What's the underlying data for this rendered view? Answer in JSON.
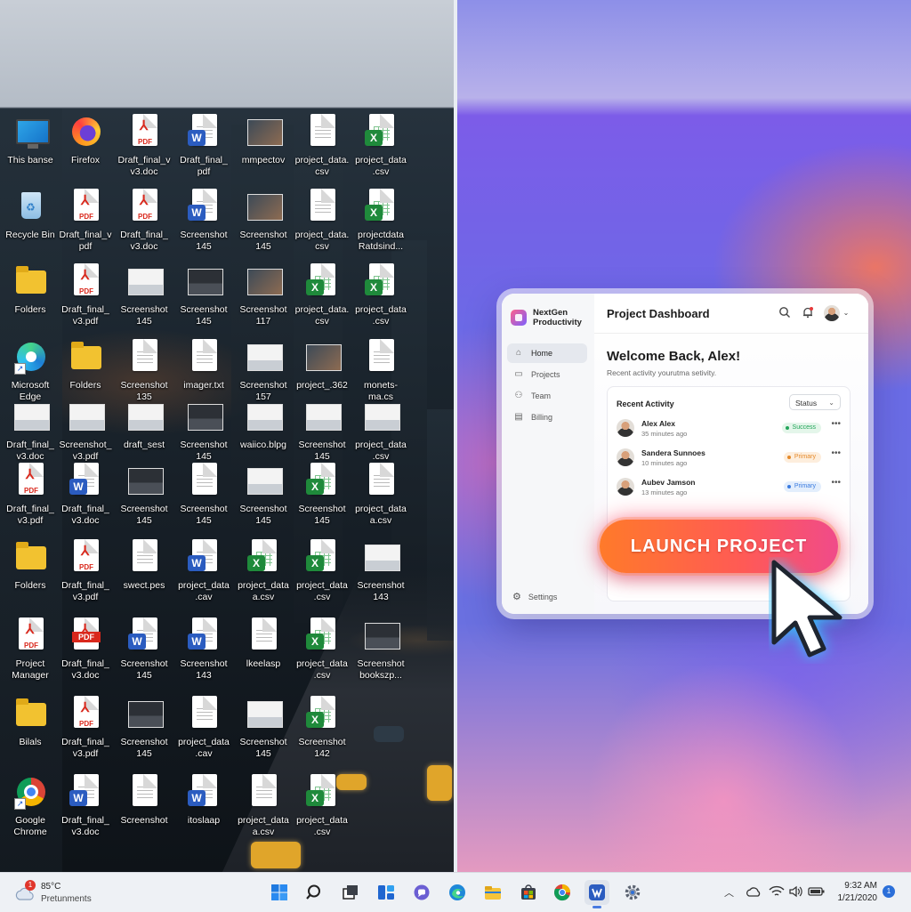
{
  "desktop": {
    "icons": [
      {
        "label": "This banse",
        "type": "monitor"
      },
      {
        "label": "Firefox",
        "type": "firefox"
      },
      {
        "label": "Draft_final_v v3.doc",
        "type": "pdf"
      },
      {
        "label": "Draft_final_ pdf",
        "type": "word"
      },
      {
        "label": "mmpectov",
        "type": "photo"
      },
      {
        "label": "project_data. csv",
        "type": "doc"
      },
      {
        "label": "project_data .csv",
        "type": "excel"
      },
      {
        "label": "Recycle Bin",
        "type": "bin"
      },
      {
        "label": "Draft_final_v pdf",
        "type": "pdf"
      },
      {
        "label": "Draft_final_ v3.doc",
        "type": "pdf"
      },
      {
        "label": "Screenshot 145",
        "type": "word"
      },
      {
        "label": "Screenshot 145",
        "type": "photo"
      },
      {
        "label": "project_data. csv",
        "type": "doc"
      },
      {
        "label": "projectdata Ratdsind...",
        "type": "excel"
      },
      {
        "label": "Folders",
        "type": "folder"
      },
      {
        "label": "Draft_final_ v3.pdf",
        "type": "pdf"
      },
      {
        "label": "Screenshot 145",
        "type": "thumb-light"
      },
      {
        "label": "Screenshot 145",
        "type": "thumb-dark"
      },
      {
        "label": "Screenshot 117",
        "type": "photo"
      },
      {
        "label": "project_data. csv",
        "type": "excel"
      },
      {
        "label": "project_data .csv",
        "type": "excel"
      },
      {
        "label": "Microsoft Edge",
        "type": "edge"
      },
      {
        "label": "Folders",
        "type": "folder"
      },
      {
        "label": "Screenshot 135",
        "type": "doc"
      },
      {
        "label": "imager.txt",
        "type": "doc"
      },
      {
        "label": "Screenshot 157",
        "type": "thumb-light"
      },
      {
        "label": "project_.362",
        "type": "photo"
      },
      {
        "label": "monets- ma.cs",
        "type": "doc"
      },
      {
        "label": "Draft_final_ v3.doc",
        "type": "thumb-light"
      },
      {
        "label": "Screenshot_ v3.pdf",
        "type": "thumb-light"
      },
      {
        "label": "draft_sest",
        "type": "thumb-light"
      },
      {
        "label": "Screenshot 145",
        "type": "thumb-dark"
      },
      {
        "label": "waiico.blpg",
        "type": "thumb-light"
      },
      {
        "label": "Screenshot 145",
        "type": "thumb-light"
      },
      {
        "label": "project_data .csv",
        "type": "thumb-light"
      },
      {
        "label": "Draft_final_ v3.pdf",
        "type": "pdf"
      },
      {
        "label": "Draft_final_ v3.doc",
        "type": "word"
      },
      {
        "label": "Screenshot 145",
        "type": "thumb-dark"
      },
      {
        "label": "Screenshot 145",
        "type": "doc"
      },
      {
        "label": "Screenshot 145",
        "type": "thumb-light"
      },
      {
        "label": "Screenshot 145",
        "type": "excel"
      },
      {
        "label": "project_data a.csv",
        "type": "doc"
      },
      {
        "label": "Folders",
        "type": "folder"
      },
      {
        "label": "Draft_final_ v3.pdf",
        "type": "pdf"
      },
      {
        "label": "swect.pes",
        "type": "doc"
      },
      {
        "label": "project_data .cav",
        "type": "word"
      },
      {
        "label": "project_data a.csv",
        "type": "excel"
      },
      {
        "label": "project_data .csv",
        "type": "excel"
      },
      {
        "label": "Screenshot 143",
        "type": "thumb-light"
      },
      {
        "label": "Project Manager",
        "type": "pdf"
      },
      {
        "label": "Draft_final_ v3.doc",
        "type": "pdf-red"
      },
      {
        "label": "Screenshot 145",
        "type": "word"
      },
      {
        "label": "Screenshot 143",
        "type": "word"
      },
      {
        "label": "lkeelasp",
        "type": "doc"
      },
      {
        "label": "project_data .csv",
        "type": "excel"
      },
      {
        "label": "Screenshot bookszp...",
        "type": "thumb-dark"
      },
      {
        "label": "Bilals",
        "type": "folder"
      },
      {
        "label": "Draft_final_ v3.pdf",
        "type": "pdf"
      },
      {
        "label": "Screenshot 145",
        "type": "thumb-dark"
      },
      {
        "label": "project_data .cav",
        "type": "doc"
      },
      {
        "label": "Screenshot 145",
        "type": "thumb-light"
      },
      {
        "label": "Screenshot 142",
        "type": "excel"
      },
      {
        "label": "",
        "type": "none"
      },
      {
        "label": "Google Chrome",
        "type": "chrome"
      },
      {
        "label": "Draft_final_ v3.doc",
        "type": "word"
      },
      {
        "label": "Screenshot",
        "type": "doc"
      },
      {
        "label": "itoslaap",
        "type": "word"
      },
      {
        "label": "project_data a.csv",
        "type": "doc"
      },
      {
        "label": "project_data .csv",
        "type": "excel"
      },
      {
        "label": "",
        "type": "none"
      }
    ]
  },
  "app": {
    "brand": "NextGen Productivity",
    "nav": [
      {
        "label": "Home",
        "icon": "home-icon",
        "active": true
      },
      {
        "label": "Projects",
        "icon": "folder-icon",
        "active": false
      },
      {
        "label": "Team",
        "icon": "team-icon",
        "active": false
      },
      {
        "label": "Billing",
        "icon": "billing-icon",
        "active": false
      }
    ],
    "settings_label": "Settings",
    "header_title": "Project Dashboard",
    "welcome": "Welcome Back, Alex!",
    "subtitle": "Recent activity yourutma setivity.",
    "card_title": "Recent Activity",
    "status_select": "Status",
    "activity": [
      {
        "name": "Alex Alex",
        "time": "35 minutes ago",
        "status": "Success",
        "color": "#22a55a",
        "bg": "#e4f6ea"
      },
      {
        "name": "Sandera Sunnoes",
        "time": "10 minutes ago",
        "status": "Primary",
        "color": "#e58a2a",
        "bg": "#fdeedd"
      },
      {
        "name": "Aubev Jamson",
        "time": "13 minutes ago",
        "status": "Primary",
        "color": "#3a7be0",
        "bg": "#e3eefc"
      }
    ],
    "launch_label": "LAUNCH PROJECT"
  },
  "taskbar": {
    "weather_temp": "85°C",
    "weather_desc": "Pretunments",
    "weather_alert": "1",
    "time": "9:32 AM",
    "date": "1/21/2020",
    "notifications": "1"
  },
  "colors": {
    "accent": "#ff5a55",
    "pdf_red": "#d9281c",
    "word_blue": "#2b5cc0",
    "excel_green": "#1f8a3b"
  }
}
